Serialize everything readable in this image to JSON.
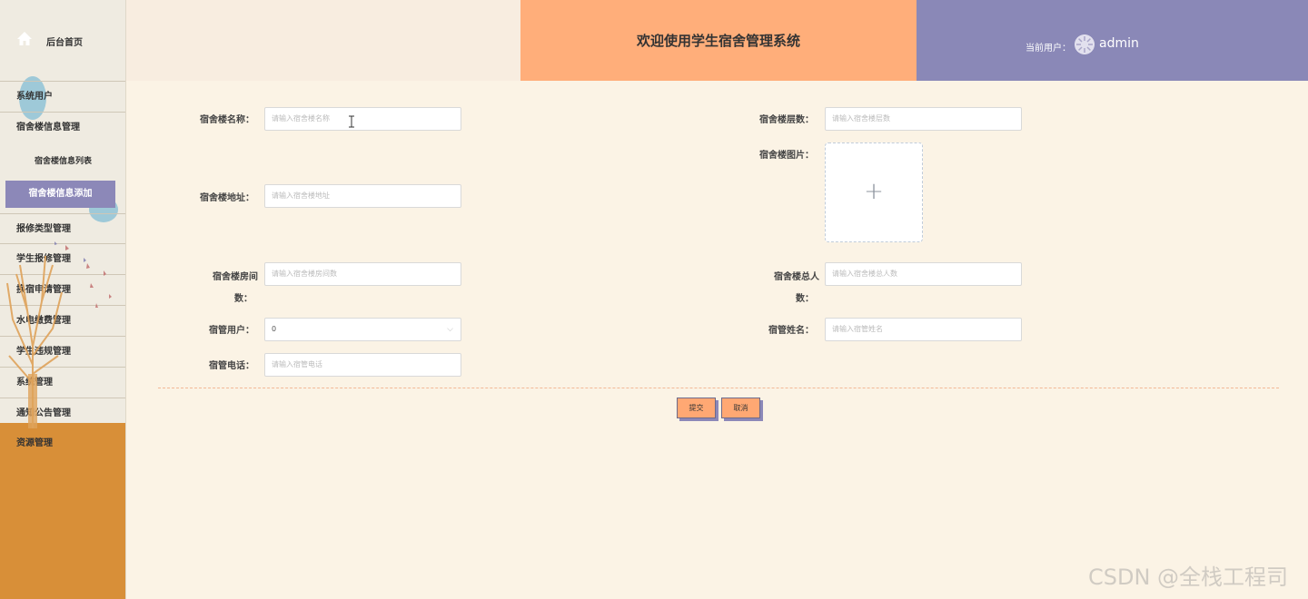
{
  "sidebar": {
    "home_label": "后台首页",
    "items": [
      {
        "label": "系统用户"
      },
      {
        "label": "宿舍楼信息管理"
      },
      {
        "label": "报修类型管理"
      },
      {
        "label": "学生报修管理"
      },
      {
        "label": "换宿申请管理"
      },
      {
        "label": "水电缴费管理"
      },
      {
        "label": "学生违规管理"
      },
      {
        "label": "系统管理"
      },
      {
        "label": "通知公告管理"
      },
      {
        "label": "资源管理"
      }
    ],
    "subitems": [
      {
        "label": "宿舍楼信息列表"
      },
      {
        "label": "宿舍楼信息添加"
      }
    ]
  },
  "header": {
    "title": "欢迎使用学生宿舍管理系统",
    "user_label": "当前用户：",
    "username": "admin"
  },
  "form": {
    "name": {
      "label": "宿舍楼名称：",
      "placeholder": "请输入宿舍楼名称"
    },
    "floors": {
      "label": "宿舍楼层数：",
      "placeholder": "请输入宿舍楼层数"
    },
    "image": {
      "label": "宿舍楼图片：",
      "plus": "+"
    },
    "address": {
      "label": "宿舍楼地址：",
      "placeholder": "请输入宿舍楼地址"
    },
    "rooms": {
      "label_line1": "宿舍楼房间",
      "label_line2": "数：",
      "placeholder": "请输入宿舍楼房间数"
    },
    "total": {
      "label_line1": "宿舍楼总人",
      "label_line2": "数：",
      "placeholder": "请输入宿舍楼总人数"
    },
    "manager_user": {
      "label": "宿管用户：",
      "value": "0"
    },
    "manager_name": {
      "label": "宿管姓名：",
      "placeholder": "请输入宿管姓名"
    },
    "manager_phone": {
      "label": "宿管电话：",
      "placeholder": "请输入宿管电话"
    }
  },
  "buttons": {
    "submit": "提交",
    "cancel": "取消"
  },
  "watermark": "CSDN @全栈工程司"
}
